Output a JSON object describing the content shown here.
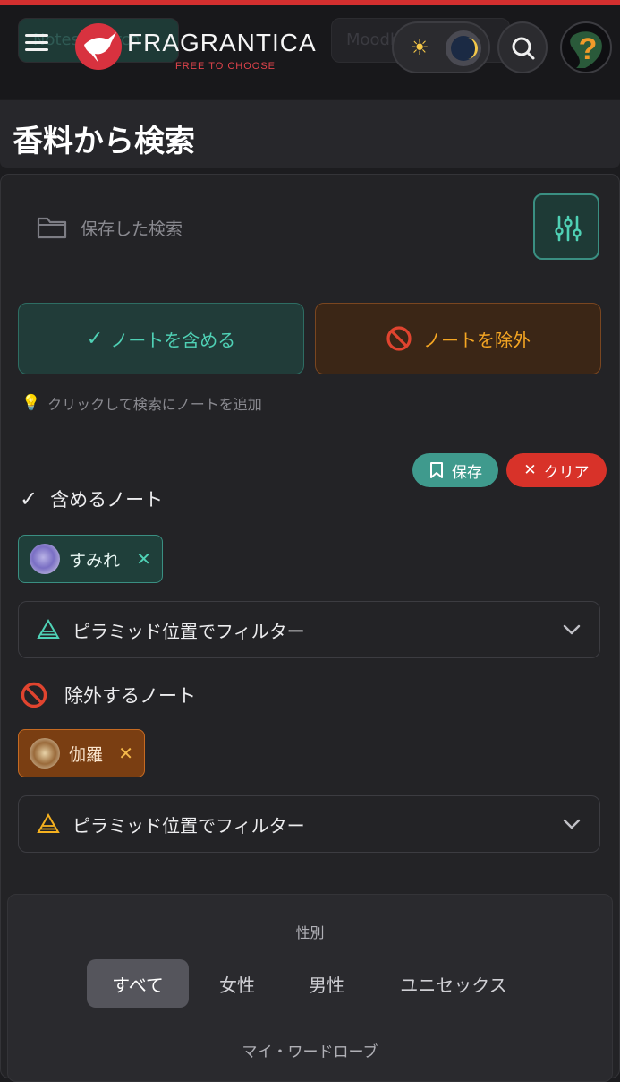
{
  "header": {
    "brand": "FRAGRANTICA",
    "tagline": "FREE TO CHOOSE",
    "ghost_left_text": "Notes Search",
    "ghost_right_text": "Moodboard",
    "theme": {
      "sun_icon": "sun-icon",
      "moon_icon": "moon-icon"
    },
    "icons": {
      "menu": "hamburger-menu-icon",
      "search": "search-icon",
      "help": "question-mark-icon",
      "logo": "hummingbird-logo"
    }
  },
  "page": {
    "title": "香料から検索"
  },
  "saved_search": {
    "label": "保存した検索"
  },
  "modes": {
    "include_label": "ノートを含める",
    "exclude_label": "ノートを除外"
  },
  "hint": {
    "text": "クリックして検索にノートを追加"
  },
  "actions": {
    "save_label": "保存",
    "clear_label": "クリア"
  },
  "included": {
    "heading": "含めるノート",
    "notes": [
      {
        "name": "すみれ"
      }
    ],
    "filter_label": "ピラミッド位置でフィルター"
  },
  "excluded": {
    "heading": "除外するノート",
    "notes": [
      {
        "name": "伽羅"
      }
    ],
    "filter_label": "ピラミッド位置でフィルター"
  },
  "gender": {
    "label": "性別",
    "options": [
      "すべて",
      "女性",
      "男性",
      "ユニセックス"
    ],
    "selected": "すべて"
  },
  "wardrobe": {
    "label": "マイ・ワードローブ"
  },
  "colors": {
    "accent_teal": "#4fd1b5",
    "accent_orange": "#f5a623",
    "danger": "#d83229",
    "brand_red": "#d8323f"
  }
}
